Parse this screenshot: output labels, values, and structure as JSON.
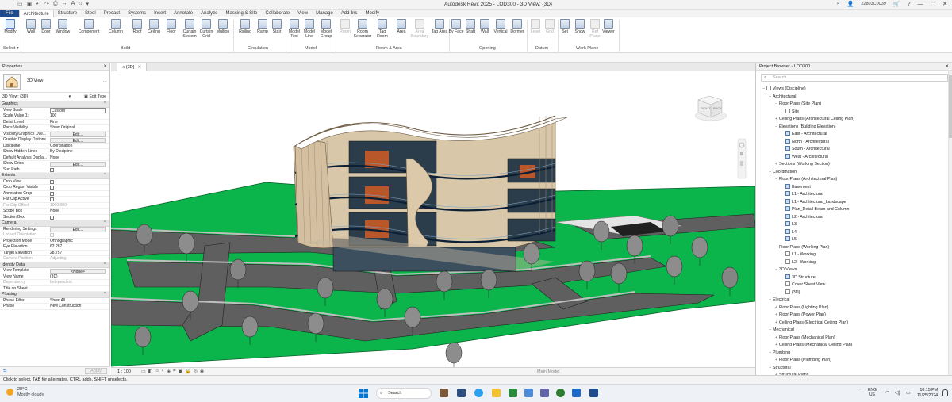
{
  "window": {
    "title": "Autodesk Revit 2025 - LOD300 - 3D View: {3D}",
    "user": "22803C0039"
  },
  "tabs": [
    "File",
    "Architecture",
    "Structure",
    "Steel",
    "Precast",
    "Systems",
    "Insert",
    "Annotate",
    "Analyze",
    "Massing & Site",
    "Collaborate",
    "View",
    "Manage",
    "Add-Ins",
    "Modify"
  ],
  "active_tab": "Architecture",
  "ribbon": {
    "select": {
      "modify": "Modify",
      "label": "Select"
    },
    "build": {
      "wall": "Wall",
      "door": "Door",
      "window": "Window",
      "component": "Component",
      "column": "Column",
      "roof": "Roof",
      "ceiling": "Ceiling",
      "floor": "Floor",
      "curtain_system": "Curtain System",
      "curtain_grid": "Curtain Grid",
      "mullion": "Mullion",
      "label": "Build"
    },
    "circulation": {
      "railing": "Railing",
      "ramp": "Ramp",
      "stair": "Stair",
      "label": "Circulation"
    },
    "model": {
      "model_text": "Model Text",
      "model_line": "Model Line",
      "model_group": "Model Group",
      "label": "Model"
    },
    "room_area": {
      "room": "Room",
      "room_separator": "Room Separator",
      "tag_room": "Tag Room",
      "area": "Area",
      "area_boundary": "Area Boundary",
      "tag_area": "Tag Area",
      "label": "Room & Area"
    },
    "opening": {
      "by_face": "By Face",
      "shaft": "Shaft",
      "wall": "Wall",
      "vertical": "Vertical",
      "dormer": "Dormer",
      "label": "Opening"
    },
    "datum": {
      "level": "Level",
      "grid": "Grid",
      "label": "Datum"
    },
    "work_plane": {
      "set": "Set",
      "show": "Show",
      "ref_plane": "Ref Plane",
      "viewer": "Viewer",
      "label": "Work Plane"
    }
  },
  "properties": {
    "title": "Properties",
    "type_name": "3D View",
    "selector": "3D View: {3D}",
    "edit_type": "Edit Type",
    "groups": {
      "graphics": "Graphics",
      "extents": "Extents",
      "camera": "Camera",
      "identity": "Identity Data",
      "phasing": "Phasing"
    },
    "rows": {
      "view_scale": [
        "View Scale",
        "Custom"
      ],
      "scale_value": [
        "Scale Value    1:",
        "100"
      ],
      "detail_level": [
        "Detail Level",
        "Fine"
      ],
      "parts_visibility": [
        "Parts Visibility",
        "Show Original"
      ],
      "vg_overrides": [
        "Visibility/Graphics Ove...",
        "Edit..."
      ],
      "gdo": [
        "Graphic Display Options",
        "Edit..."
      ],
      "discipline": [
        "Discipline",
        "Coordination"
      ],
      "hidden_lines": [
        "Show Hidden Lines",
        "By Discipline"
      ],
      "analysis_display": [
        "Default Analysis Displa...",
        "None"
      ],
      "show_grids": [
        "Show Grids",
        "Edit..."
      ],
      "sun_path": [
        "Sun Path",
        ""
      ],
      "crop_view": [
        "Crop View",
        ""
      ],
      "crop_visible": [
        "Crop Region Visible",
        ""
      ],
      "annotation_crop": [
        "Annotation Crop",
        ""
      ],
      "far_clip_active": [
        "Far Clip Active",
        ""
      ],
      "far_clip_offset": [
        "Far Clip Offset",
        "1000.000"
      ],
      "scope_box": [
        "Scope Box",
        "None"
      ],
      "section_box": [
        "Section Box",
        ""
      ],
      "rendering": [
        "Rendering Settings",
        "Edit..."
      ],
      "locked": [
        "Locked Orientation",
        ""
      ],
      "projection": [
        "Projection Mode",
        "Orthographic"
      ],
      "eye_elev": [
        "Eye Elevation",
        "62.287"
      ],
      "target_elev": [
        "Target Elevation",
        "28.757"
      ],
      "camera_pos": [
        "Camera Position",
        "Adjusting"
      ],
      "template": [
        "View Template",
        "<None>"
      ],
      "view_name": [
        "View Name",
        "{3D}"
      ],
      "dependency": [
        "Dependency",
        "Independent"
      ],
      "title_sheet": [
        "Title on Sheet",
        ""
      ],
      "phase_filter": [
        "Phase Filter",
        "Show All"
      ],
      "phase": [
        "Phase",
        "New Construction"
      ]
    },
    "apply": "Apply"
  },
  "view": {
    "tab": "{3D}",
    "scale": "1 : 100",
    "main_model": "Main Model",
    "viewcube": {
      "right": "RIGHT",
      "back": "BACK"
    }
  },
  "browser": {
    "title": "Project Browser - LOD300",
    "search_placeholder": "Search",
    "items": [
      {
        "t": "Views (Discipline)",
        "d": 0,
        "g": "−",
        "i": "blank"
      },
      {
        "t": "Architectural",
        "d": 1,
        "g": "−"
      },
      {
        "t": "Floor Plans (Site Plan)",
        "d": 2,
        "g": "−"
      },
      {
        "t": "Site",
        "d": 3,
        "g": "",
        "i": "blank"
      },
      {
        "t": "Ceiling Plans (Architectural Ceiling Plan)",
        "d": 2,
        "g": "+"
      },
      {
        "t": "Elevations (Building Elevation)",
        "d": 2,
        "g": "−"
      },
      {
        "t": "East - Architectural",
        "d": 3,
        "g": "",
        "i": "view"
      },
      {
        "t": "North - Architectural",
        "d": 3,
        "g": "",
        "i": "view"
      },
      {
        "t": "South - Architectural",
        "d": 3,
        "g": "",
        "i": "view"
      },
      {
        "t": "West - Architectural",
        "d": 3,
        "g": "",
        "i": "view"
      },
      {
        "t": "Sections (Working Section)",
        "d": 2,
        "g": "+"
      },
      {
        "t": "Coordination",
        "d": 1,
        "g": "−"
      },
      {
        "t": "Floor Plans (Architectural Plan)",
        "d": 2,
        "g": "−"
      },
      {
        "t": "Basement",
        "d": 3,
        "g": "",
        "i": "view"
      },
      {
        "t": "L1 - Architectural",
        "d": 3,
        "g": "",
        "i": "view"
      },
      {
        "t": "L1 - Architectural_Landscape",
        "d": 3,
        "g": "",
        "i": "view"
      },
      {
        "t": "Plan_Detail Beam and Column",
        "d": 3,
        "g": "",
        "i": "view"
      },
      {
        "t": "L2 - Architectural",
        "d": 3,
        "g": "",
        "i": "view"
      },
      {
        "t": "L3",
        "d": 3,
        "g": "",
        "i": "view"
      },
      {
        "t": "L4",
        "d": 3,
        "g": "",
        "i": "view"
      },
      {
        "t": "L5",
        "d": 3,
        "g": "",
        "i": "view"
      },
      {
        "t": "Floor Plans (Working Plan)",
        "d": 2,
        "g": "−"
      },
      {
        "t": "L1 - Working",
        "d": 3,
        "g": "",
        "i": "blank"
      },
      {
        "t": "L2 - Working",
        "d": 3,
        "g": "",
        "i": "blank"
      },
      {
        "t": "3D Views",
        "d": 2,
        "g": "−"
      },
      {
        "t": "3D Structure",
        "d": 3,
        "g": "",
        "i": "view"
      },
      {
        "t": "Cover Sheet View",
        "d": 3,
        "g": "",
        "i": "blank"
      },
      {
        "t": "{3D}",
        "d": 3,
        "g": "",
        "i": "blank"
      },
      {
        "t": "Electrical",
        "d": 1,
        "g": "−"
      },
      {
        "t": "Floor Plans (Lighting Plan)",
        "d": 2,
        "g": "+"
      },
      {
        "t": "Floor Plans (Power Plan)",
        "d": 2,
        "g": "+"
      },
      {
        "t": "Ceiling Plans (Electrical Ceiling Plan)",
        "d": 2,
        "g": "+"
      },
      {
        "t": "Mechanical",
        "d": 1,
        "g": "−"
      },
      {
        "t": "Floor Plans (Mechanical Plan)",
        "d": 2,
        "g": "+"
      },
      {
        "t": "Ceiling Plans (Mechanical Ceiling Plan)",
        "d": 2,
        "g": "+"
      },
      {
        "t": "Plumbing",
        "d": 1,
        "g": "−"
      },
      {
        "t": "Floor Plans (Plumbing Plan)",
        "d": 2,
        "g": "+"
      },
      {
        "t": "Structural",
        "d": 1,
        "g": "−"
      },
      {
        "t": "Structural Plans",
        "d": 2,
        "g": "+"
      }
    ]
  },
  "status": "Click to select, TAB for alternates, CTRL adds, SHIFT unselects.",
  "taskbar": {
    "temp": "28°C",
    "weather": "Mostly cloudy",
    "search": "Search",
    "lang1": "ENG",
    "lang2": "US",
    "time": "10:15 PM",
    "date": "11/25/2024"
  },
  "colors": {
    "file_tab": "#1e4c8c",
    "grass": "#0bb54b",
    "road": "#5f5f5f",
    "facade": "#d8c6a8"
  }
}
